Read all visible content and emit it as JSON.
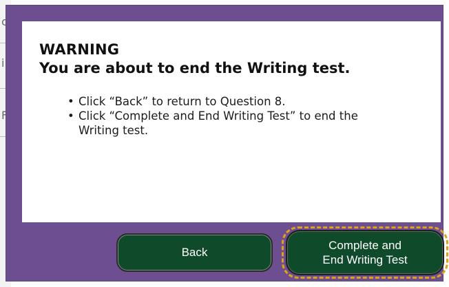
{
  "background": {
    "fragments": [
      "c",
      "i",
      "F"
    ]
  },
  "dialog": {
    "heading": "WARNING",
    "title": "You are about to end the Writing test.",
    "instructions": [
      "Click “Back” to return to Question 8.",
      "Click “Complete and End Writing Test” to end the Writing test."
    ],
    "buttons": {
      "back": "Back",
      "complete_line_1": "Complete and",
      "complete_line_2": "End Writing Test"
    }
  },
  "colors": {
    "frame": "#6d4f91",
    "button": "#0f4b2a",
    "focus": "#e0a11a"
  }
}
